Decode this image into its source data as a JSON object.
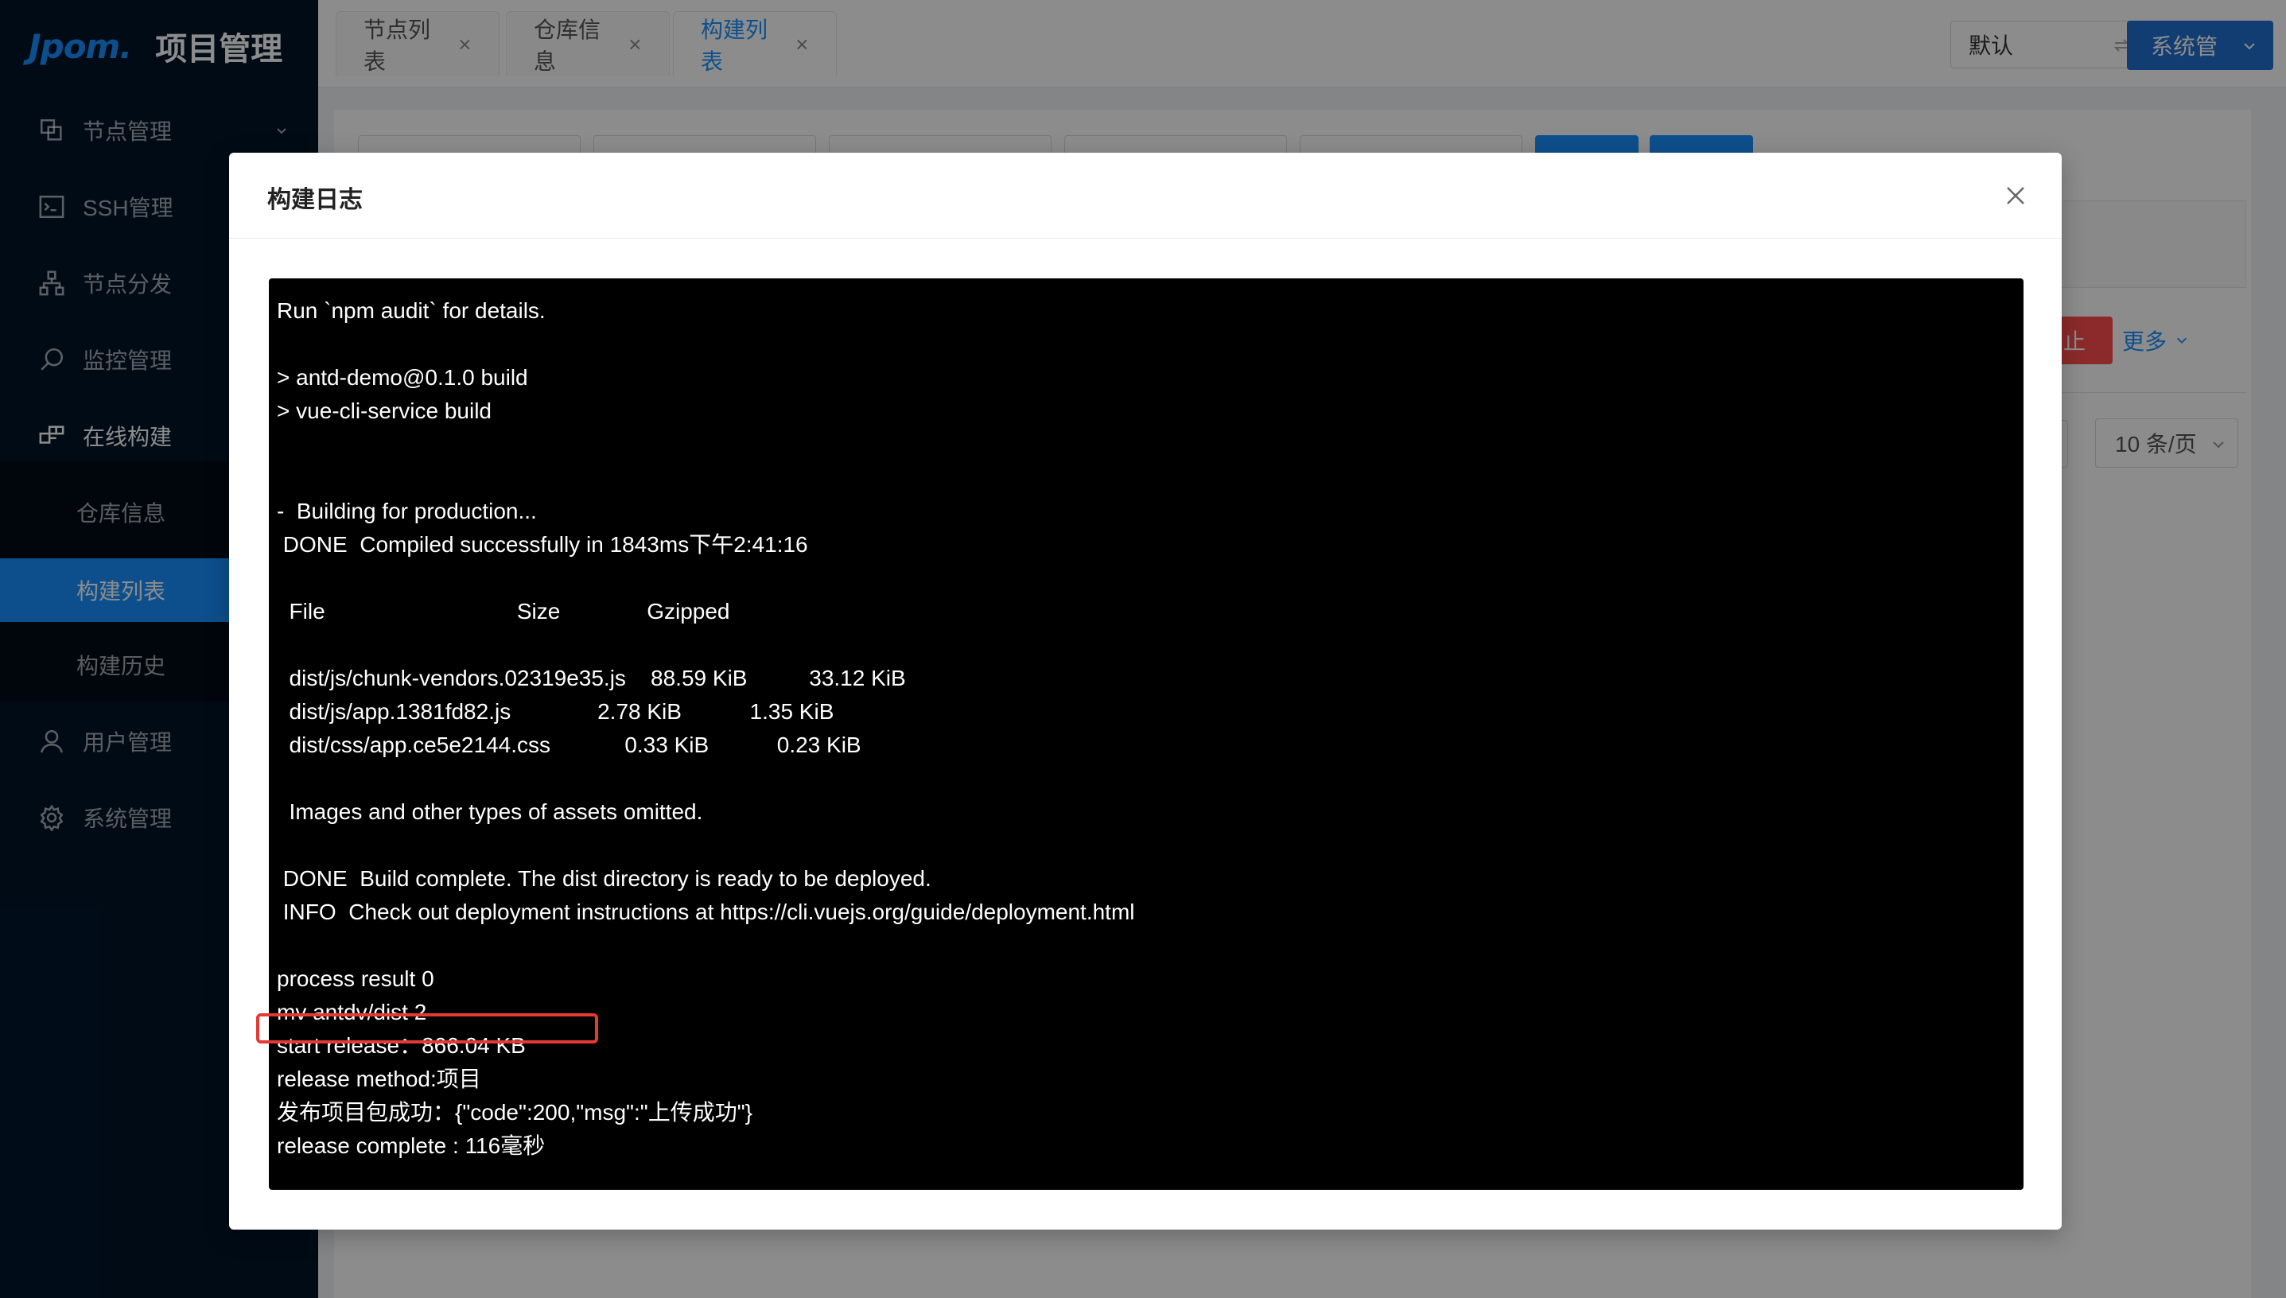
{
  "app": {
    "logo": "Jpom.",
    "title": "项目管理"
  },
  "sidebar": {
    "items": [
      {
        "label": "节点管理",
        "icon": "node-manage-icon"
      },
      {
        "label": "SSH管理",
        "icon": "terminal-icon"
      },
      {
        "label": "节点分发",
        "icon": "distribute-icon"
      },
      {
        "label": "监控管理",
        "icon": "monitor-icon"
      },
      {
        "label": "在线构建",
        "icon": "build-icon"
      },
      {
        "label": "用户管理",
        "icon": "user-icon"
      },
      {
        "label": "系统管理",
        "icon": "gear-icon"
      }
    ],
    "subitems": [
      {
        "label": "仓库信息"
      },
      {
        "label": "构建列表",
        "active": true
      },
      {
        "label": "构建历史"
      }
    ]
  },
  "header": {
    "tabs": [
      {
        "label": "节点列表"
      },
      {
        "label": "仓库信息"
      },
      {
        "label": "构建列表",
        "active": true
      }
    ],
    "env_select": "默认",
    "user_button": "系统管"
  },
  "content": {
    "stop_button": "止",
    "more_link": "更多",
    "page_size": "10 条/页"
  },
  "modal": {
    "title": "构建日志",
    "log_lines": [
      "Run `npm audit` for details.",
      "",
      "> antd-demo@0.1.0 build",
      "> vue-cli-service build",
      "",
      "",
      "-  Building for production...",
      " DONE  Compiled successfully in 1843ms下午2:41:16",
      "",
      "  File                               Size              Gzipped",
      "",
      "  dist/js/chunk-vendors.02319e35.js    88.59 KiB          33.12 KiB",
      "  dist/js/app.1381fd82.js              2.78 KiB           1.35 KiB",
      "  dist/css/app.ce5e2144.css            0.33 KiB           0.23 KiB",
      "",
      "  Images and other types of assets omitted.",
      "",
      " DONE  Build complete. The dist directory is ready to be deployed.",
      " INFO  Check out deployment instructions at https://cli.vuejs.org/guide/deployment.html",
      "",
      "process result 0",
      "mv antdv/dist 2",
      "start release：866.04 KB",
      "release method:项目",
      "发布项目包成功：{\"code\":200,\"msg\":\"上传成功\"}",
      "release complete : 116毫秒"
    ]
  },
  "colors": {
    "sidebar_bg": "#001529",
    "primary": "#1890ff",
    "danger": "#ff4d4f",
    "highlight": "#e53935"
  }
}
